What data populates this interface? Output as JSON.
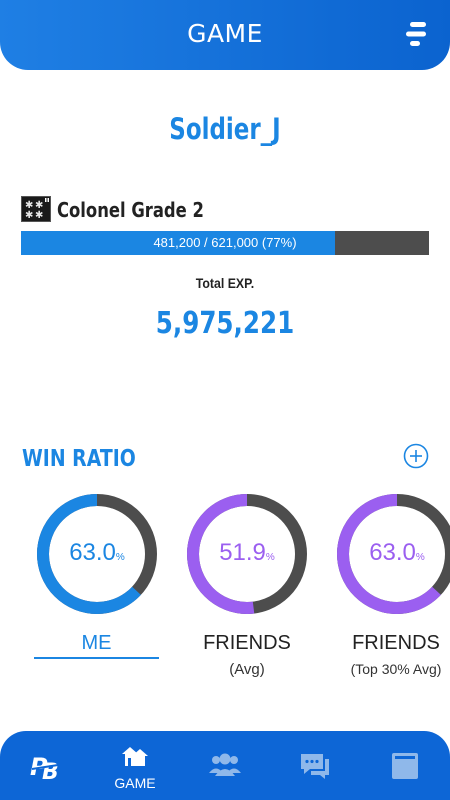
{
  "header": {
    "title": "GAME",
    "menu_icon": "menu-icon"
  },
  "player": {
    "name": "Soldier_J",
    "rank_label": "Colonel Grade 2",
    "rank_icon": "rank-insignia-icon",
    "exp_text": "481,200 / 621,000 (77%)",
    "exp_progress": 0.77,
    "total_exp_label": "Total EXP.",
    "total_exp_value": "5,975,221"
  },
  "win_ratio": {
    "title": "WIN RATIO",
    "add_icon": "add-circle-icon",
    "unit": "%",
    "items": [
      {
        "value": "63.0",
        "percent": 63.0,
        "label": "ME",
        "sub": "",
        "color": "#1b86e2",
        "selected": true
      },
      {
        "value": "51.9",
        "percent": 51.9,
        "label": "FRIENDS",
        "sub": "(Avg)",
        "color": "#9b5ff0",
        "selected": false
      },
      {
        "value": "63.0",
        "percent": 63.0,
        "label": "FRIENDS",
        "sub": "(Top 30% Avg)",
        "color": "#9b5ff0",
        "selected": false
      }
    ],
    "remainder_color": "#4d4d4d"
  },
  "bottom_nav": {
    "items": [
      {
        "icon": "brand-logo-icon",
        "label": ""
      },
      {
        "icon": "game-icon",
        "label": "GAME"
      },
      {
        "icon": "friends-icon",
        "label": ""
      },
      {
        "icon": "chat-icon",
        "label": ""
      },
      {
        "icon": "wallet-icon",
        "label": ""
      }
    ]
  },
  "colors": {
    "accent": "#1b86e2",
    "nav_bg": "#0d66d6",
    "friends": "#9b5ff0",
    "bar_bg": "#4d4d4d"
  }
}
